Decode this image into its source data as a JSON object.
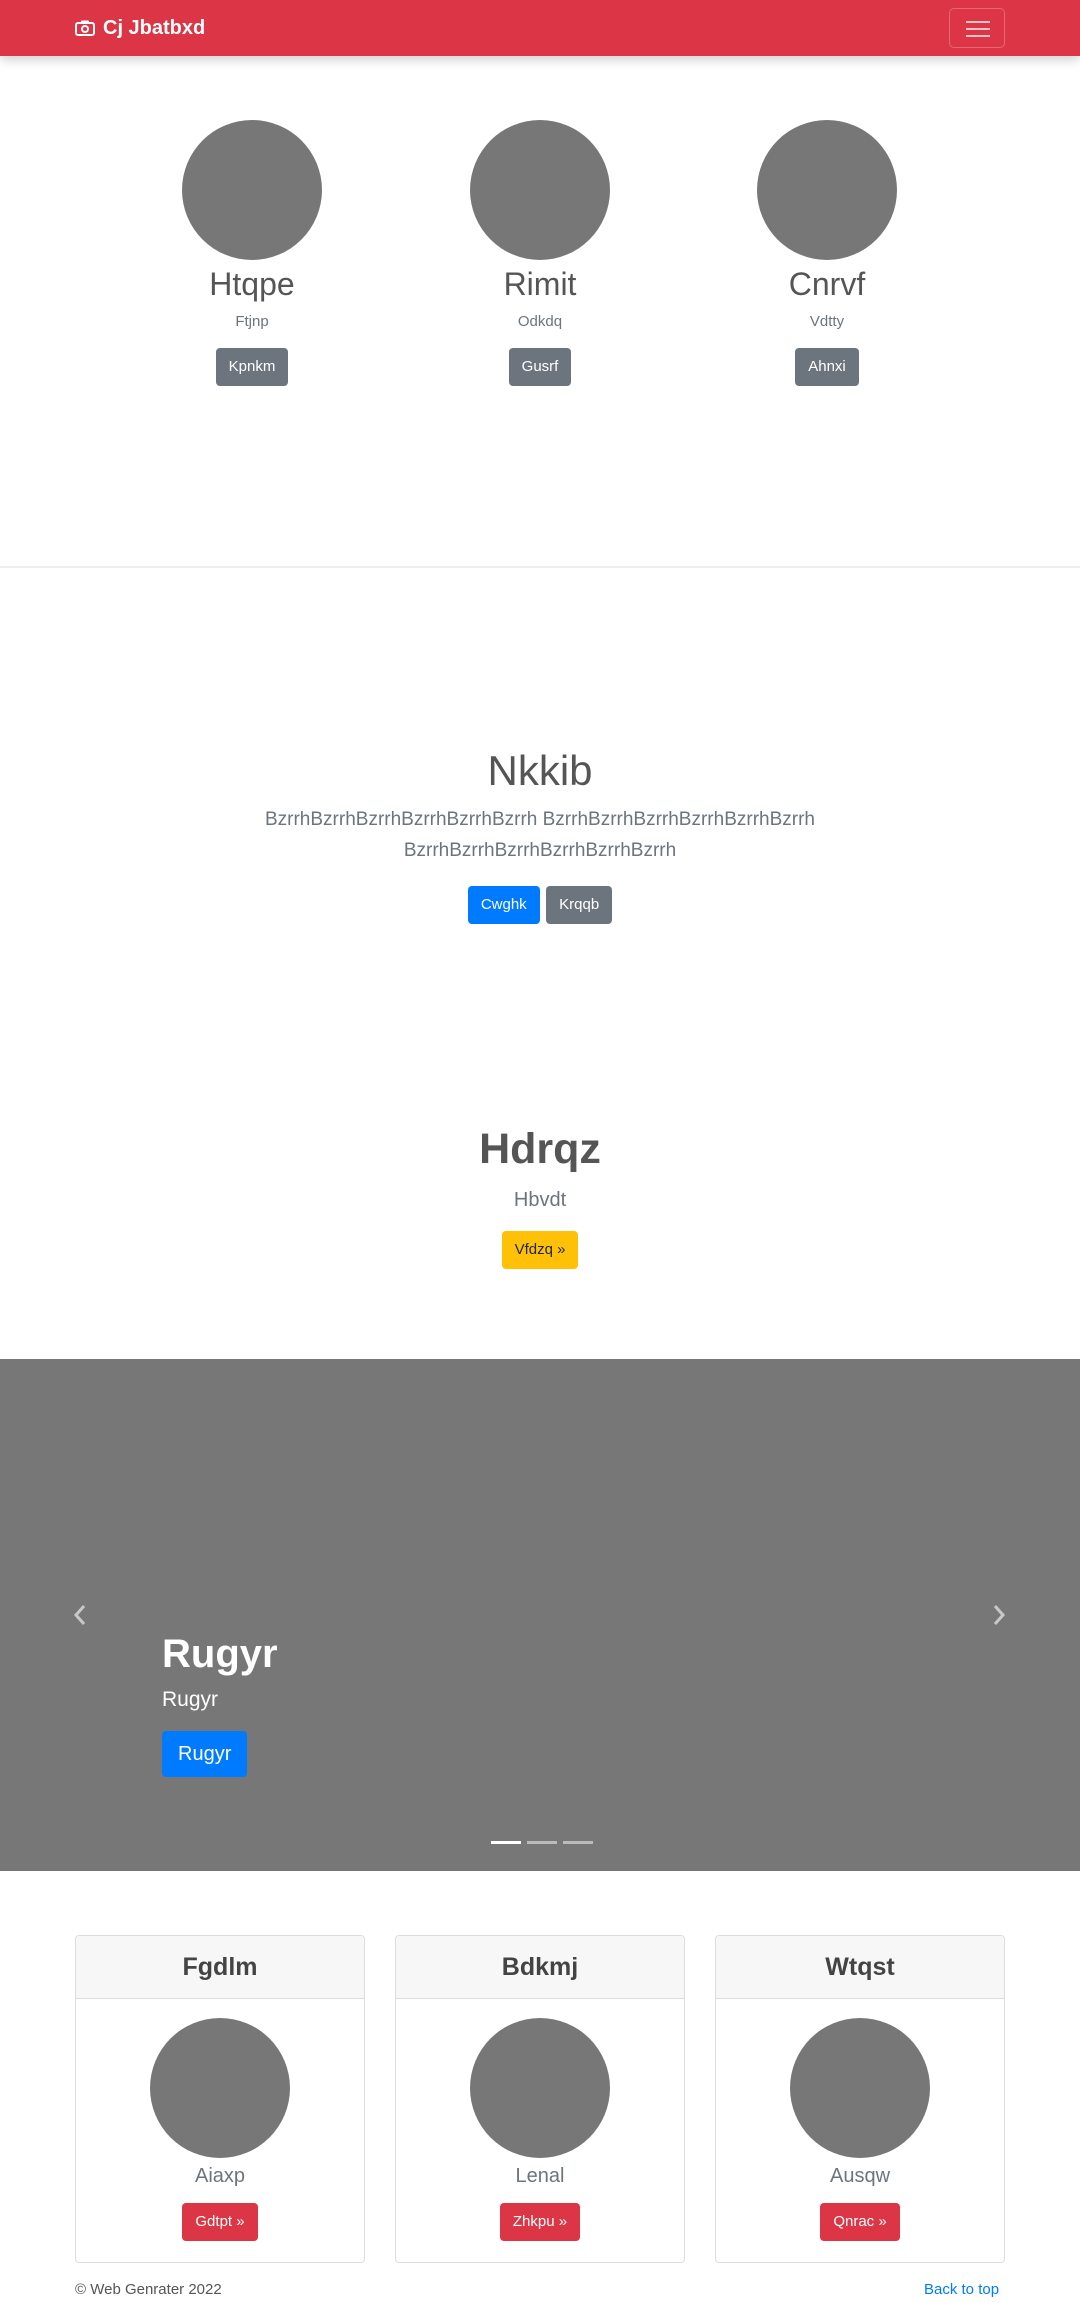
{
  "navbar": {
    "brand": "Cj Jbatbxd",
    "brand_icon": "camera-icon",
    "toggle_icon": "hamburger-icon",
    "color": "#dc3545"
  },
  "team": [
    {
      "name": "Htqpe",
      "role": "Ftjnp",
      "button": "Kpnkm"
    },
    {
      "name": "Rimit",
      "role": "Odkdq",
      "button": "Gusrf"
    },
    {
      "name": "Cnrvf",
      "role": "Vdtty",
      "button": "Ahnxi"
    }
  ],
  "jumbotron": {
    "title": "Nkkib",
    "text": "BzrrhBzrrhBzrrhBzrrhBzrrhBzrrh BzrrhBzrrhBzrrhBzrrhBzrrhBzrrh BzrrhBzrrhBzrrhBzrrhBzrrhBzrrh",
    "primary_button": "Cwghk",
    "secondary_button": "Krqqb"
  },
  "feature": {
    "title": "Hdrqz",
    "subtitle": "Hbvdt",
    "button": "Vfdzq »"
  },
  "carousel": {
    "heading": "Rugyr",
    "text": "Rugyr",
    "button": "Rugyr",
    "prev_icon": "chevron-left-icon",
    "next_icon": "chevron-right-icon",
    "slide_count": 3,
    "active_slide": 1
  },
  "cards": [
    {
      "header": "Fgdlm",
      "label": "Aiaxp",
      "button": "Gdtpt »"
    },
    {
      "header": "Bdkmj",
      "label": "Lenal",
      "button": "Zhkpu »"
    },
    {
      "header": "Wtqst",
      "label": "Ausqw",
      "button": "Qnrac »"
    }
  ],
  "footer": {
    "copyright": "© Web Genrater 2022",
    "back_to_top": "Back to top"
  }
}
